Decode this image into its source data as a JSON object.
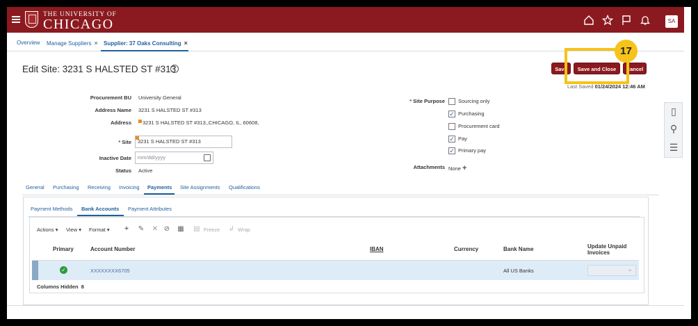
{
  "header": {
    "logo_small": "THE UNIVERSITY OF",
    "logo_big": "CHICAGO",
    "avatar": "SA",
    "icons": [
      "home-icon",
      "star-icon",
      "flag-icon",
      "bell-icon"
    ]
  },
  "tabs": [
    {
      "label": "Overview"
    },
    {
      "label": "Manage Suppliers",
      "close": "×"
    },
    {
      "label": "Supplier: 37 Oaks Consulting",
      "close": "×",
      "active": true
    }
  ],
  "page": {
    "title": "Edit Site: 3231 S HALSTED ST #313",
    "help": "?"
  },
  "actions": {
    "save": "Save",
    "save_close": "Save and Close",
    "cancel": "Cancel",
    "step": "17",
    "last_saved_label": "Last Saved",
    "last_saved_value": "01/24/2024 12:46 AM"
  },
  "form": {
    "procurement_bu_label": "Procurement BU",
    "procurement_bu_value": "University General",
    "address_name_label": "Address Name",
    "address_name_value": "3231 S HALSTED ST #313",
    "address_label": "Address",
    "address_value": "3231 S HALSTED ST #313,,CHICAGO, IL, 60608,",
    "site_label": "Site",
    "site_value": "3231 S HALSTED ST #313",
    "inactive_date_label": "Inactive Date",
    "inactive_date_placeholder": "mm/dd/yyyy",
    "status_label": "Status",
    "status_value": "Active",
    "site_purpose_label": "Site Purpose",
    "purposes": [
      {
        "label": "Sourcing only",
        "checked": false
      },
      {
        "label": "Purchasing",
        "checked": true
      },
      {
        "label": "Procurement card",
        "checked": false
      },
      {
        "label": "Pay",
        "checked": true
      },
      {
        "label": "Primary pay",
        "checked": true
      }
    ],
    "attachments_label": "Attachments",
    "attachments_value": "None",
    "required_mark": "*"
  },
  "subtabs": [
    "General",
    "Purchasing",
    "Receiving",
    "Invoicing",
    "Payments",
    "Site Assignments",
    "Qualifications"
  ],
  "payment_tabs": [
    "Payment Methods",
    "Bank Accounts",
    "Payment Attributes"
  ],
  "toolbar": {
    "actions": "Actions",
    "view": "View",
    "format": "Format",
    "freeze": "Freeze",
    "wrap": "Wrap"
  },
  "table": {
    "columns": [
      "Primary",
      "Account Number",
      "IBAN",
      "Currency",
      "Bank Name",
      "Update Unpaid",
      "Invoices"
    ],
    "rows": [
      {
        "primary": "✓",
        "account_number": "XXXXXXXX6705",
        "iban": "",
        "currency": "",
        "bank_name": "All US Banks",
        "update_unpaid": ""
      }
    ],
    "columns_hidden_label": "Columns Hidden",
    "columns_hidden_value": "8"
  }
}
